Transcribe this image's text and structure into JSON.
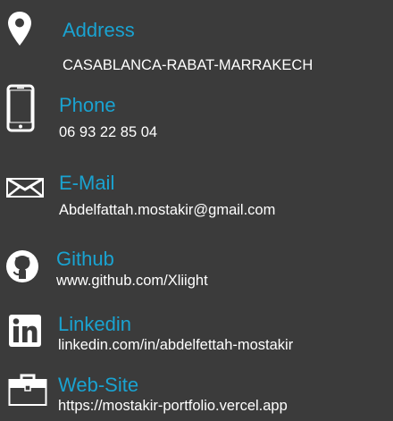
{
  "contacts": [
    {
      "label": "Address",
      "value": "CASABLANCA-RABAT-MARRAKECH",
      "icon": "map-pin-icon"
    },
    {
      "label": "Phone",
      "value": "06 93 22 85 04",
      "icon": "phone-icon"
    },
    {
      "label": "E-Mail",
      "value": "Abdelfattah.mostakir@gmail.com",
      "icon": "envelope-icon"
    },
    {
      "label": "Github",
      "value": "www.github.com/Xliight",
      "icon": "github-icon"
    },
    {
      "label": "Linkedin",
      "value": "linkedin.com/in/abdelfettah-mostakir",
      "icon": "linkedin-icon"
    },
    {
      "label": "Web-Site",
      "value": "https://mostakir-portfolio.vercel.app",
      "icon": "briefcase-icon"
    }
  ],
  "colors": {
    "background": "#3b3b3b",
    "label": "#1aa3d1",
    "value": "#ffffff",
    "icon": "#ffffff"
  }
}
